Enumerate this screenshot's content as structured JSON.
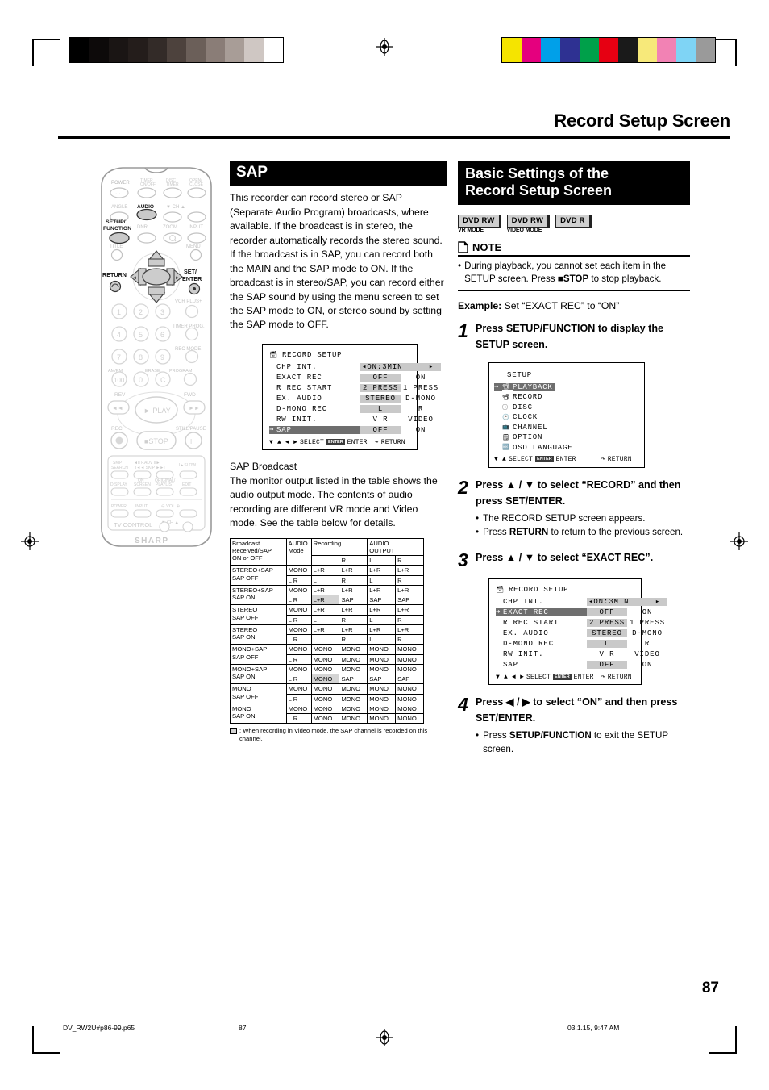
{
  "document": {
    "header_title": "Record Setup Screen",
    "page_number": "87",
    "footer": {
      "file": "DV_RW2U#p86-99.p65",
      "page": "87",
      "date": "03.1.15, 9:47 AM"
    },
    "calibration": {
      "gray_bar": [
        "#000000",
        "#0d0a0a",
        "#1a1514",
        "#241d1b",
        "#332b28",
        "#4d423d",
        "#6b5f59",
        "#8a7d77",
        "#a89d97",
        "#cfc7c3",
        "#ffffff"
      ],
      "color_bar": [
        "#f5e400",
        "#e5007e",
        "#00a0e9",
        "#2e3192",
        "#00a04a",
        "#e60012",
        "#1a1a1a",
        "#f7e97a",
        "#f282b4",
        "#7fd4f5",
        "#9a9a9a"
      ]
    }
  },
  "remote": {
    "name": "remote-control-illustration",
    "brand": "SHARP",
    "labels": {
      "power": "POWER",
      "timer_onoff": "TIMER\nON/OFF",
      "disc_timer": "DISC\nTIMER",
      "open_close": "OPEN/\nCLOSE",
      "angle": "ANGLE",
      "audio": "AUDIO",
      "ch": "CH",
      "setup_function": "SETUP/\nFUNCTION",
      "dnr": "DNR",
      "zoom": "ZOOM",
      "input": "INPUT",
      "title": "TITLE",
      "menu": "MENU",
      "return": "RETURN",
      "set_enter": "SET/\nENTER",
      "vcr_plus": "VCR PLUS+",
      "timer_prog": "TIMER PROG.",
      "rec_mode": "REC MODE",
      "am_pm": "AM/PM",
      "erase": "ERASE",
      "program": "PROGRAM",
      "rev": "REV",
      "fwd": "FWD",
      "play": "PLAY",
      "rec": "REC",
      "stop": "STOP",
      "still_pause": "STILL/PAUSE",
      "skip_search": "SKIP\nSEARCH",
      "f_adv": "F.ADV\nSKIP",
      "slow": "SLOW",
      "display": "DISPLAY",
      "on_screen": "ON\nSCREEN",
      "original_playlist": "ORIGINAL/\nPLAYLIST",
      "edit": "EDIT",
      "tv_power": "POWER",
      "tv_input": "INPUT",
      "vol": "VOL",
      "tv_ch": "CH",
      "tv_control": "TV CONTROL",
      "numbers": [
        "1",
        "2",
        "3",
        "4",
        "5",
        "6",
        "7",
        "8",
        "9",
        "100",
        "0",
        "C"
      ]
    }
  },
  "sap_section": {
    "heading": "SAP",
    "body": "This recorder can record stereo or SAP (Separate Audio Program) broadcasts, where available. If the broadcast is in stereo, the recorder automatically records the stereo sound. If the broadcast is in SAP, you can record both the MAIN and the SAP mode to ON. If the broadcast is in stereo/SAP, you can record either the SAP sound by using the menu screen to set the SAP mode to ON, or stereo sound by setting the SAP mode to OFF.",
    "subheading": "SAP Broadcast",
    "body2": "The monitor output listed in the table shows the audio output mode. The contents of audio recording are different VR mode and Video mode. See the table below for details.",
    "table_note": ": When recording in Video mode, the SAP channel is recorded on this channel."
  },
  "osd_sap": {
    "title": "RECORD SETUP",
    "footer": {
      "select": "SELECT",
      "enter_key": "ENTER",
      "enter": "ENTER",
      "return": "RETURN"
    },
    "rows": [
      {
        "label": "CHP INT.",
        "v1": "◂ON:3MIN",
        "v2": "▸",
        "sel": false,
        "h1": true,
        "h2": false,
        "wide": true
      },
      {
        "label": "EXACT REC",
        "v1": "OFF",
        "v2": "ON",
        "sel": false,
        "h1": true,
        "h2": false
      },
      {
        "label": "R REC START",
        "v1": "2 PRESS",
        "v2": "1 PRESS",
        "sel": false,
        "h1": true,
        "h2": false
      },
      {
        "label": "EX. AUDIO",
        "v1": "STEREO",
        "v2": "D-MONO",
        "sel": false,
        "h1": true,
        "h2": false
      },
      {
        "label": "D-MONO REC",
        "v1": "L",
        "v2": "R",
        "sel": false,
        "h1": true,
        "h2": false
      },
      {
        "label": "RW INIT.",
        "v1": "V R",
        "v2": "VIDEO",
        "sel": false,
        "h1": false,
        "h2": false
      },
      {
        "label": "SAP",
        "v1": "OFF",
        "v2": "ON",
        "sel": true,
        "h1": true,
        "h2": false
      }
    ]
  },
  "sap_table": {
    "headers": {
      "broadcast": "Broadcast Received/SAP ON or OFF",
      "audio_mode": "AUDIO Mode",
      "recording": "Recording",
      "audio_output": "AUDIO OUTPUT",
      "rec_l": "L",
      "rec_r": "R",
      "out_l": "L",
      "out_r": "R"
    },
    "rows": [
      {
        "broadcast": "STEREO+SAP SAP OFF",
        "lines": [
          {
            "mode": "MONO",
            "rec_l": "L+R",
            "rec_r": "L+R",
            "out_l": "L+R",
            "out_r": "L+R",
            "shade": ""
          },
          {
            "mode": "L R",
            "rec_l": "L",
            "rec_r": "R",
            "out_l": "L",
            "out_r": "R",
            "shade": ""
          }
        ]
      },
      {
        "broadcast": "STEREO+SAP SAP ON",
        "lines": [
          {
            "mode": "MONO",
            "rec_l": "L+R",
            "rec_r": "L+R",
            "out_l": "L+R",
            "out_r": "L+R",
            "shade": ""
          },
          {
            "mode": "L R",
            "rec_l": "L+R",
            "rec_r": "SAP",
            "out_l": "SAP",
            "out_r": "SAP",
            "shade": "rec_l"
          }
        ]
      },
      {
        "broadcast": "STEREO SAP OFF",
        "lines": [
          {
            "mode": "MONO",
            "rec_l": "L+R",
            "rec_r": "L+R",
            "out_l": "L+R",
            "out_r": "L+R",
            "shade": ""
          },
          {
            "mode": "L R",
            "rec_l": "L",
            "rec_r": "R",
            "out_l": "L",
            "out_r": "R",
            "shade": ""
          }
        ]
      },
      {
        "broadcast": "STEREO SAP ON",
        "lines": [
          {
            "mode": "MONO",
            "rec_l": "L+R",
            "rec_r": "L+R",
            "out_l": "L+R",
            "out_r": "L+R",
            "shade": ""
          },
          {
            "mode": "L R",
            "rec_l": "L",
            "rec_r": "R",
            "out_l": "L",
            "out_r": "R",
            "shade": ""
          }
        ]
      },
      {
        "broadcast": "MONO+SAP SAP OFF",
        "lines": [
          {
            "mode": "MONO",
            "rec_l": "MONO",
            "rec_r": "MONO",
            "out_l": "MONO",
            "out_r": "MONO",
            "shade": ""
          },
          {
            "mode": "L R",
            "rec_l": "MONO",
            "rec_r": "MONO",
            "out_l": "MONO",
            "out_r": "MONO",
            "shade": ""
          }
        ]
      },
      {
        "broadcast": "MONO+SAP SAP ON",
        "lines": [
          {
            "mode": "MONO",
            "rec_l": "MONO",
            "rec_r": "MONO",
            "out_l": "MONO",
            "out_r": "MONO",
            "shade": ""
          },
          {
            "mode": "L R",
            "rec_l": "MONO",
            "rec_r": "SAP",
            "out_l": "SAP",
            "out_r": "SAP",
            "shade": "rec_l"
          }
        ]
      },
      {
        "broadcast": "MONO SAP OFF",
        "lines": [
          {
            "mode": "MONO",
            "rec_l": "MONO",
            "rec_r": "MONO",
            "out_l": "MONO",
            "out_r": "MONO",
            "shade": ""
          },
          {
            "mode": "L R",
            "rec_l": "MONO",
            "rec_r": "MONO",
            "out_l": "MONO",
            "out_r": "MONO",
            "shade": ""
          }
        ]
      },
      {
        "broadcast": "MONO SAP ON",
        "lines": [
          {
            "mode": "MONO",
            "rec_l": "MONO",
            "rec_r": "MONO",
            "out_l": "MONO",
            "out_r": "MONO",
            "shade": ""
          },
          {
            "mode": "L R",
            "rec_l": "MONO",
            "rec_r": "MONO",
            "out_l": "MONO",
            "out_r": "MONO",
            "shade": ""
          }
        ]
      }
    ]
  },
  "basic_section": {
    "heading_line1": "Basic Settings of the",
    "heading_line2": "Record Setup Screen",
    "badges": [
      {
        "main": "DVD RW",
        "sub": "VR MODE"
      },
      {
        "main": "DVD RW",
        "sub": "VIDEO MODE"
      },
      {
        "main": "DVD R",
        "sub": ""
      }
    ],
    "note": {
      "label": "NOTE",
      "bullet": "•",
      "text_a": "During playback, you cannot set each item in the SETUP screen. Press ",
      "text_b": "■STOP",
      "text_c": " to stop playback."
    },
    "example_label": "Example:",
    "example_text": " Set “EXACT REC” to “ON”",
    "steps": [
      {
        "num": "1",
        "text_html": "Press <b>SETUP/FUNCTION</b> to display the SETUP screen.",
        "bullets": []
      },
      {
        "num": "2",
        "text_html": "Press ▲ / ▼ to select “RECORD” and then press <b>SET/ENTER</b>.",
        "bullets": [
          "The RECORD SETUP screen appears.",
          "Press <b>RETURN</b> to return to the previous screen."
        ]
      },
      {
        "num": "3",
        "text_html": "Press ▲ / ▼ to select “EXACT REC”.",
        "bullets": []
      },
      {
        "num": "4",
        "text_html": "Press ◀ / ▶ to select “ON” and then press <b>SET/ENTER</b>.",
        "bullets": [
          "Press <b>SETUP/FUNCTION</b> to exit the SETUP screen."
        ]
      }
    ]
  },
  "osd_setup": {
    "title": "SETUP",
    "footer": {
      "select": "SELECT",
      "enter_key": "ENTER",
      "enter": "ENTER",
      "return": "RETURN"
    },
    "items": [
      {
        "label": "PLAYBACK",
        "sel": true
      },
      {
        "label": "RECORD",
        "sel": false
      },
      {
        "label": "DISC",
        "sel": false
      },
      {
        "label": "CLOCK",
        "sel": false
      },
      {
        "label": "CHANNEL",
        "sel": false
      },
      {
        "label": "OPTION",
        "sel": false
      },
      {
        "label": "OSD LANGUAGE",
        "sel": false
      }
    ]
  },
  "osd_record": {
    "title": "RECORD SETUP",
    "footer": {
      "select": "SELECT",
      "enter_key": "ENTER",
      "enter": "ENTER",
      "return": "RETURN"
    },
    "rows": [
      {
        "label": "CHP INT.",
        "v1": "◂ON:3MIN",
        "v2": "▸",
        "sel": false,
        "h1": true,
        "h2": false,
        "wide": true
      },
      {
        "label": "EXACT REC",
        "v1": "OFF",
        "v2": "ON",
        "sel": true,
        "h1": true,
        "h2": false
      },
      {
        "label": "R REC START",
        "v1": "2 PRESS",
        "v2": "1 PRESS",
        "sel": false,
        "h1": true,
        "h2": false
      },
      {
        "label": "EX. AUDIO",
        "v1": "STEREO",
        "v2": "D-MONO",
        "sel": false,
        "h1": true,
        "h2": false
      },
      {
        "label": "D-MONO REC",
        "v1": "L",
        "v2": "R",
        "sel": false,
        "h1": true,
        "h2": false
      },
      {
        "label": "RW INIT.",
        "v1": "V R",
        "v2": "VIDEO",
        "sel": false,
        "h1": false,
        "h2": false
      },
      {
        "label": "SAP",
        "v1": "OFF",
        "v2": "ON",
        "sel": false,
        "h1": true,
        "h2": false
      }
    ]
  }
}
